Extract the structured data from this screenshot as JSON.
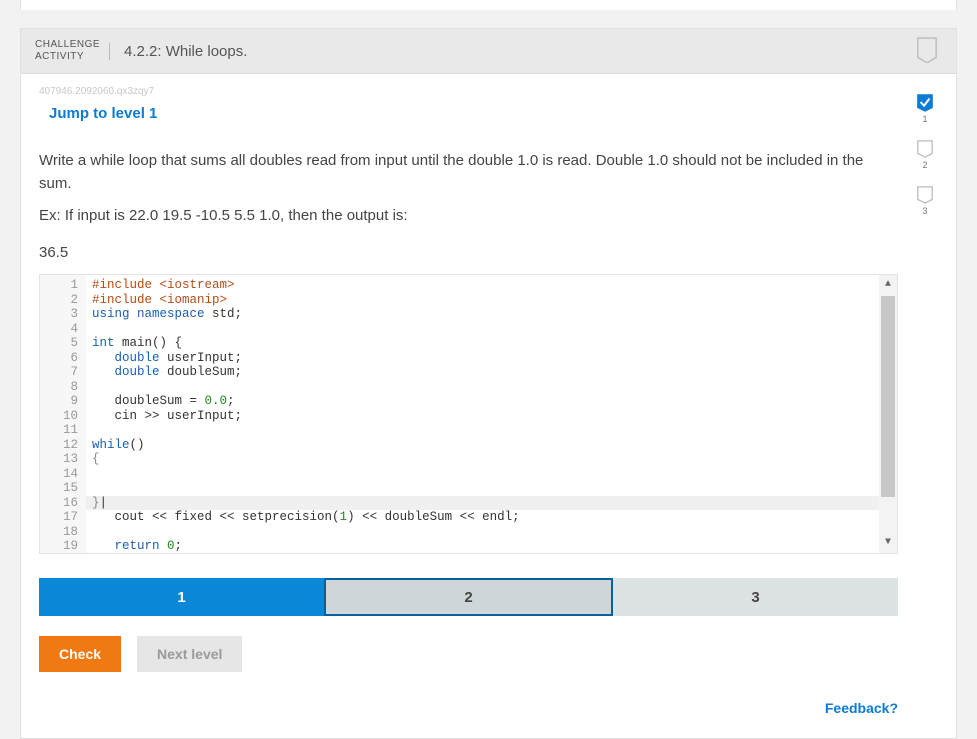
{
  "header": {
    "label_line1": "CHALLENGE",
    "label_line2": "ACTIVITY",
    "title": "4.2.2: While loops."
  },
  "hash": "407946.2092060.qx3zqy7",
  "jump_link": "Jump to level 1",
  "prompt": {
    "p1": "Write a while loop that sums all doubles read from input until the double 1.0 is read. Double 1.0 should not be included in the sum.",
    "p2": "Ex: If input is 22.0 19.5 -10.5 5.5 1.0, then the output is:",
    "result": "36.5"
  },
  "code_lines": [
    {
      "n": 1,
      "tokens": [
        [
          "#include ",
          "pre"
        ],
        [
          "<iostream>",
          "pre"
        ]
      ]
    },
    {
      "n": 2,
      "tokens": [
        [
          "#include ",
          "pre"
        ],
        [
          "<iomanip>",
          "pre"
        ]
      ]
    },
    {
      "n": 3,
      "tokens": [
        [
          "using ",
          "kw"
        ],
        [
          "namespace ",
          "ns"
        ],
        [
          "std",
          ""
        ],
        [
          ";",
          ""
        ]
      ]
    },
    {
      "n": 4,
      "tokens": [
        [
          "",
          ""
        ]
      ]
    },
    {
      "n": 5,
      "tokens": [
        [
          "int ",
          "kw"
        ],
        [
          "main",
          ""
        ],
        [
          "() {",
          ""
        ]
      ]
    },
    {
      "n": 6,
      "tokens": [
        [
          "   ",
          ""
        ],
        [
          "double ",
          "kw"
        ],
        [
          "userInput;",
          ""
        ]
      ]
    },
    {
      "n": 7,
      "tokens": [
        [
          "   ",
          ""
        ],
        [
          "double ",
          "kw"
        ],
        [
          "doubleSum;",
          ""
        ]
      ]
    },
    {
      "n": 8,
      "tokens": [
        [
          "",
          ""
        ]
      ]
    },
    {
      "n": 9,
      "tokens": [
        [
          "   doubleSum = ",
          ""
        ],
        [
          "0.0",
          "num"
        ],
        [
          ";",
          ""
        ]
      ]
    },
    {
      "n": 10,
      "tokens": [
        [
          "   cin >> userInput;",
          ""
        ]
      ]
    },
    {
      "n": 11,
      "tokens": [
        [
          "",
          ""
        ]
      ]
    },
    {
      "n": 12,
      "tokens": [
        [
          "while",
          "kw"
        ],
        [
          "()",
          ""
        ]
      ]
    },
    {
      "n": 13,
      "tokens": [
        [
          "{",
          "brace"
        ]
      ]
    },
    {
      "n": 14,
      "tokens": [
        [
          "",
          ""
        ]
      ]
    },
    {
      "n": 15,
      "tokens": [
        [
          "",
          ""
        ]
      ]
    },
    {
      "n": 16,
      "tokens": [
        [
          "}",
          "brace"
        ],
        [
          "|",
          ""
        ]
      ],
      "active": true
    },
    {
      "n": 17,
      "tokens": [
        [
          "   cout << fixed << setprecision(",
          ""
        ],
        [
          "1",
          "num"
        ],
        [
          ") << doubleSum << endl;",
          ""
        ]
      ]
    },
    {
      "n": 18,
      "tokens": [
        [
          "",
          ""
        ]
      ]
    },
    {
      "n": 19,
      "tokens": [
        [
          "   ",
          ""
        ],
        [
          "return ",
          "kw"
        ],
        [
          "0",
          "num"
        ],
        [
          ";",
          ""
        ]
      ]
    }
  ],
  "tracker": [
    {
      "n": "1",
      "done": true
    },
    {
      "n": "2",
      "done": false
    },
    {
      "n": "3",
      "done": false
    }
  ],
  "level_bar": [
    {
      "label": "1",
      "state": "active"
    },
    {
      "label": "2",
      "state": "current"
    },
    {
      "label": "3",
      "state": "idle"
    }
  ],
  "buttons": {
    "check": "Check",
    "next": "Next level"
  },
  "feedback": "Feedback?"
}
